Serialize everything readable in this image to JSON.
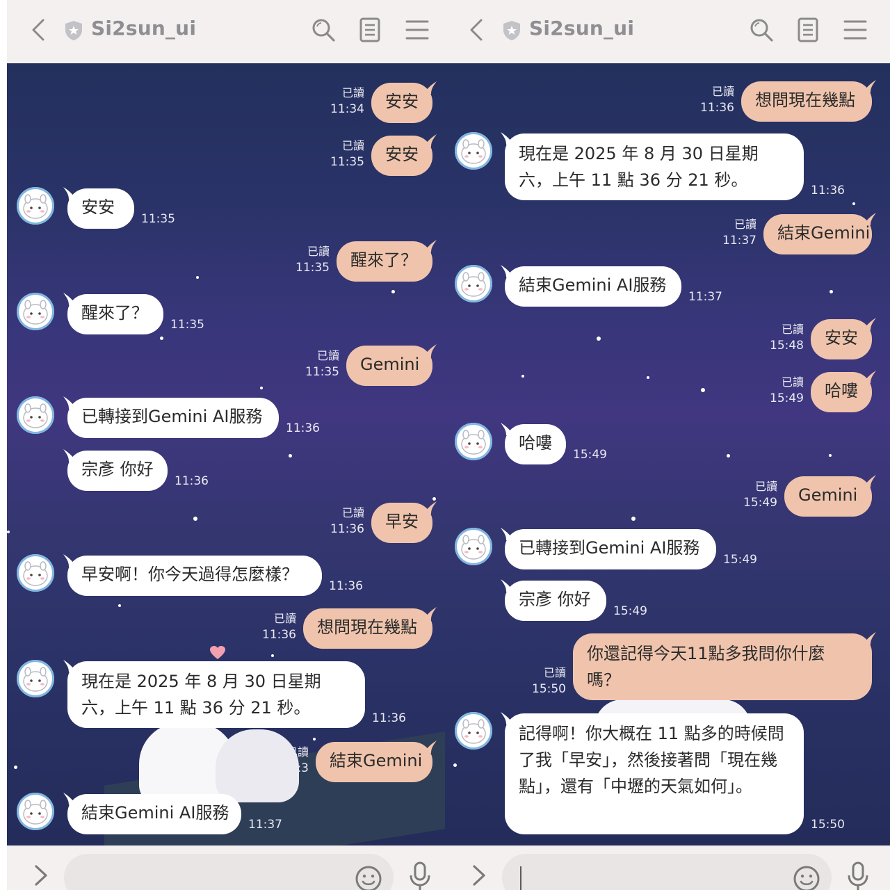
{
  "header": {
    "title": "Si2sun_ui"
  },
  "status": {
    "read": "已讀"
  },
  "left_messages": [
    {
      "dir": "out",
      "text": "安安",
      "time": "11:34"
    },
    {
      "dir": "out",
      "text": "安安",
      "time": "11:35"
    },
    {
      "dir": "in",
      "text": "安安",
      "time": "11:35"
    },
    {
      "dir": "out",
      "text": "醒來了？",
      "time": "11:35"
    },
    {
      "dir": "in",
      "text": "醒來了？",
      "time": "11:35"
    },
    {
      "dir": "out",
      "text": "Gemini",
      "time": "11:35"
    },
    {
      "dir": "in",
      "text": "已轉接到Gemini AI服務",
      "time": "11:36"
    },
    {
      "dir": "in",
      "text": "宗彥 你好",
      "time": "11:36"
    },
    {
      "dir": "out",
      "text": "早安",
      "time": "11:36"
    },
    {
      "dir": "in",
      "text": "早安啊！你今天過得怎麼樣？",
      "time": "11:36"
    },
    {
      "dir": "out",
      "text": "想問現在幾點",
      "time": "11:36"
    },
    {
      "dir": "in",
      "text": "現在是 2025 年 8 月 30 日星期六，上午 11 點 36 分 21 秒。",
      "time": "11:36"
    },
    {
      "dir": "out",
      "text": "結束Gemini",
      "time": "11:3"
    },
    {
      "dir": "in",
      "text": "結束Gemini AI服務",
      "time": "11:37"
    }
  ],
  "right_messages": [
    {
      "dir": "out",
      "text": "想問現在幾點",
      "time": "11:36"
    },
    {
      "dir": "in",
      "text": "現在是 2025 年 8 月 30 日星期六，上午 11 點 36 分 21 秒。",
      "time": "11:36"
    },
    {
      "dir": "out",
      "text": "結束Gemini",
      "time": "11:37"
    },
    {
      "dir": "in",
      "text": "結束Gemini AI服務",
      "time": "11:37"
    },
    {
      "dir": "out",
      "text": "安安",
      "time": "15:48"
    },
    {
      "dir": "out",
      "text": "哈嘍",
      "time": "15:49"
    },
    {
      "dir": "in",
      "text": "哈嘍",
      "time": "15:49"
    },
    {
      "dir": "out",
      "text": "Gemini",
      "time": "15:49"
    },
    {
      "dir": "in",
      "text": "已轉接到Gemini AI服務",
      "time": "15:49"
    },
    {
      "dir": "in",
      "text": "宗彥 你好",
      "time": "15:49"
    },
    {
      "dir": "out",
      "text": "你還記得今天11點多我問你什麼嗎？",
      "time": "15:50"
    },
    {
      "dir": "in",
      "text": "記得啊！你大概在 11 點多的時候問了我「早安」，然後接著問「現在幾點」，還有「中壢的天氣如何」。",
      "time": "15:50"
    }
  ],
  "colors": {
    "outgoing_bubble": "#f0c4ac",
    "incoming_bubble": "#ffffff",
    "header_bg": "#f4f0ef",
    "chat_bg": "#2f3468"
  },
  "icons": [
    "back-icon",
    "shield-icon",
    "search-icon",
    "notes-icon",
    "menu-icon",
    "expand-icon",
    "emoji-icon",
    "mic-icon"
  ]
}
